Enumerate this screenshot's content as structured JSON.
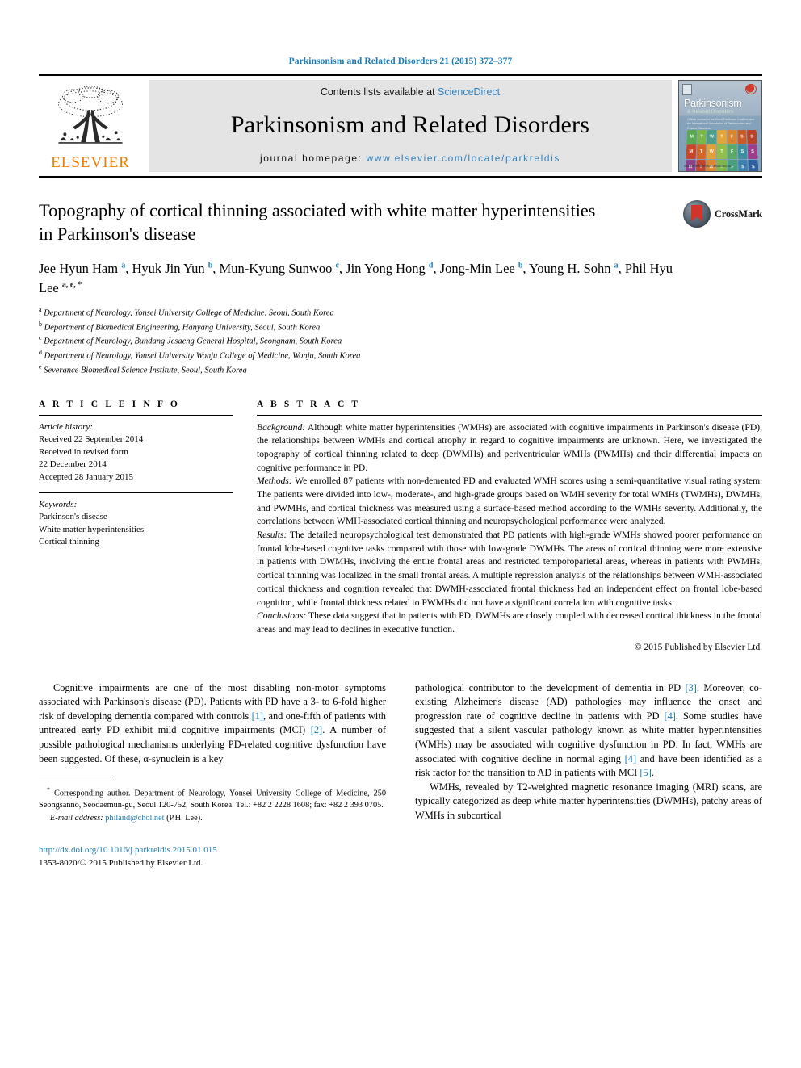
{
  "running_head": "Parkinsonism and Related Disorders 21 (2015) 372–377",
  "masthead": {
    "publisher": "ELSEVIER",
    "contents_prefix": "Contents lists available at",
    "contents_link": "ScienceDirect",
    "journal_title": "Parkinsonism and Related Disorders",
    "homepage_prefix": "journal homepage:",
    "homepage_url": "www.elsevier.com/locate/parkreldis",
    "cover": {
      "title": "Parkinsonism",
      "subtitle": "& Related Disorders",
      "tagline": "Official Journal of the World Parkinson Coalition and the International Association of Parkinsonism and Related Disorders",
      "day_letters": [
        "M",
        "T",
        "W",
        "T",
        "F",
        "S",
        "S"
      ],
      "footer": "Available online at\nwww.sciencedirect.com"
    }
  },
  "article": {
    "title": "Topography of cortical thinning associated with white matter hyperintensities in Parkinson's disease",
    "crossmark_label": "CrossMark",
    "authors": [
      {
        "name": "Jee Hyun Ham",
        "marks": "a",
        "sep": ", "
      },
      {
        "name": "Hyuk Jin Yun",
        "marks": "b",
        "sep": ", "
      },
      {
        "name": "Mun-Kyung Sunwoo",
        "marks": "c",
        "sep": ", "
      },
      {
        "name": "Jin Yong Hong",
        "marks": "d",
        "sep": ", "
      },
      {
        "name": "Jong-Min Lee",
        "marks": "b",
        "sep": ", "
      },
      {
        "name": "Young H. Sohn",
        "marks": "a",
        "sep": ", "
      },
      {
        "name": "Phil Hyu Lee",
        "marks": "a, e, *",
        "sep": ""
      }
    ],
    "affiliations": [
      {
        "mark": "a",
        "text": "Department of Neurology, Yonsei University College of Medicine, Seoul, South Korea"
      },
      {
        "mark": "b",
        "text": "Department of Biomedical Engineering, Hanyang University, Seoul, South Korea"
      },
      {
        "mark": "c",
        "text": "Department of Neurology, Bundang Jesaeng General Hospital, Seongnam, South Korea"
      },
      {
        "mark": "d",
        "text": "Department of Neurology, Yonsei University Wonju College of Medicine, Wonju, South Korea"
      },
      {
        "mark": "e",
        "text": "Severance Biomedical Science Institute, Seoul, South Korea"
      }
    ]
  },
  "article_info": {
    "heading": "A R T I C L E  I N F O",
    "history_label": "Article history:",
    "history": [
      "Received 22 September 2014",
      "Received in revised form",
      "22 December 2014",
      "Accepted 28 January 2015"
    ],
    "keywords_label": "Keywords:",
    "keywords": [
      "Parkinson's disease",
      "White matter hyperintensities",
      "Cortical thinning"
    ]
  },
  "abstract": {
    "heading": "A B S T R A C T",
    "sections": [
      {
        "lead": "Background:",
        "text": " Although white matter hyperintensities (WMHs) are associated with cognitive impairments in Parkinson's disease (PD), the relationships between WMHs and cortical atrophy in regard to cognitive impairments are unknown. Here, we investigated the topography of cortical thinning related to deep (DWMHs) and periventricular WMHs (PWMHs) and their differential impacts on cognitive performance in PD."
      },
      {
        "lead": "Methods:",
        "text": " We enrolled 87 patients with non-demented PD and evaluated WMH scores using a semi-quantitative visual rating system. The patients were divided into low-, moderate-, and high-grade groups based on WMH severity for total WMHs (TWMHs), DWMHs, and PWMHs, and cortical thickness was measured using a surface-based method according to the WMHs severity. Additionally, the correlations between WMH-associated cortical thinning and neuropsychological performance were analyzed."
      },
      {
        "lead": "Results:",
        "text": " The detailed neuropsychological test demonstrated that PD patients with high-grade WMHs showed poorer performance on frontal lobe-based cognitive tasks compared with those with low-grade DWMHs. The areas of cortical thinning were more extensive in patients with DWMHs, involving the entire frontal areas and restricted temporoparietal areas, whereas in patients with PWMHs, cortical thinning was localized in the small frontal areas. A multiple regression analysis of the relationships between WMH-associated cortical thickness and cognition revealed that DWMH-associated frontal thickness had an independent effect on frontal lobe-based cognition, while frontal thickness related to PWMHs did not have a significant correlation with cognitive tasks."
      },
      {
        "lead": "Conclusions:",
        "text": " These data suggest that in patients with PD, DWMHs are closely coupled with decreased cortical thickness in the frontal areas and may lead to declines in executive function."
      }
    ],
    "copyright": "© 2015 Published by Elsevier Ltd."
  },
  "body": {
    "left_paragraph_1": [
      {
        "t": "Cognitive impairments are one of the most disabling non-motor symptoms associated with Parkinson's disease (PD). Patients with PD have a 3- to 6-fold higher risk of developing dementia compared with controls "
      },
      {
        "t": "[1]",
        "ref": true
      },
      {
        "t": ", and one-fifth of patients with untreated early PD exhibit mild cognitive impairments (MCI) "
      },
      {
        "t": "[2]",
        "ref": true
      },
      {
        "t": ". A number of possible pathological mechanisms underlying PD-related cognitive dysfunction have been suggested. Of these, α-synuclein is a key"
      }
    ],
    "right_paragraph_1": [
      {
        "t": "pathological contributor to the development of dementia in PD "
      },
      {
        "t": "[3]",
        "ref": true
      },
      {
        "t": ". Moreover, co-existing Alzheimer's disease (AD) pathologies may influence the onset and progression rate of cognitive decline in patients with PD "
      },
      {
        "t": "[4]",
        "ref": true
      },
      {
        "t": ". Some studies have suggested that a silent vascular pathology known as white matter hyperintensities (WMHs) may be associated with cognitive dysfunction in PD. In fact, WMHs are associated with cognitive decline in normal aging "
      },
      {
        "t": "[4]",
        "ref": true
      },
      {
        "t": " and have been identified as a risk factor for the transition to AD in patients with MCI "
      },
      {
        "t": "[5]",
        "ref": true
      },
      {
        "t": "."
      }
    ],
    "right_paragraph_2": [
      {
        "t": "WMHs, revealed by T2-weighted magnetic resonance imaging (MRI) scans, are typically categorized as deep white matter hyperintensities (DWMHs), patchy areas of WMHs in subcortical"
      }
    ]
  },
  "footer": {
    "corresponding_marker": "*",
    "corresponding_text": " Corresponding author. Department of Neurology, Yonsei University College of Medicine, 250 Seongsanno, Seodaemun-gu, Seoul 120-752, South Korea. Tel.: +82 2 2228 1608; fax: +82 2 393 0705.",
    "email_label": "E-mail address:",
    "email": "philand@chol.net",
    "email_owner": "(P.H. Lee).",
    "doi": "http://dx.doi.org/10.1016/j.parkreldis.2015.01.015",
    "issn_line": "1353-8020/© 2015 Published by Elsevier Ltd."
  },
  "colors": {
    "link_blue": "#1a7db6",
    "sd_blue": "#2e83c4",
    "elsevier_orange": "#f07d00",
    "crossmark_red": "#d2332a",
    "masthead_gray": "#e4e4e4"
  }
}
